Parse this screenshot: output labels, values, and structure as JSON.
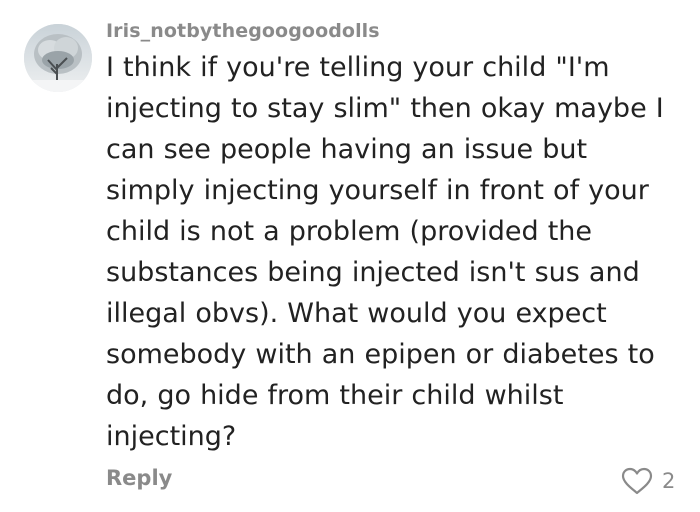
{
  "comment": {
    "username": "Iris_notbythegoogoodolls",
    "text_lines": [
      "I think if you're telling your child \"I'm",
      "injecting to stay slim\" then okay maybe I",
      "can see people having an issue but",
      "simply injecting yourself in front of your",
      "child is not a problem (provided the",
      "substances being injected isn't sus and",
      "illegal obvs). What would you expect",
      "somebody with an epipen or diabetes to",
      "do, go hide from their child whilst",
      "injecting?"
    ],
    "reply_label": "Reply",
    "like_count": "2",
    "like_icon": "heart-outline-icon"
  },
  "colors": {
    "meta_gray": "#8a8a8a",
    "text": "#222222",
    "background": "#ffffff"
  }
}
